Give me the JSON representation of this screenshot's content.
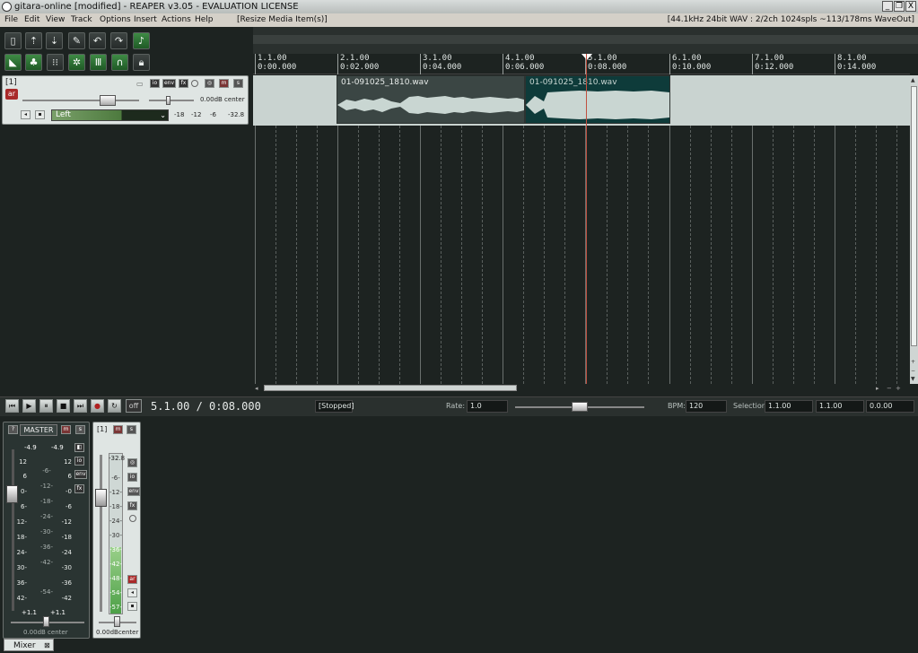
{
  "window": {
    "title": "gitara-online [modified] - REAPER v3.05 - EVALUATION LICENSE",
    "controls": [
      "_",
      "❐",
      "X"
    ]
  },
  "menu": {
    "items": [
      "File",
      "Edit",
      "View",
      "Track",
      "Options",
      "Insert",
      "Actions",
      "Help"
    ],
    "last_action": "[Resize Media Item(s)]",
    "audio_status": "[44.1kHz 24bit WAV : 2/2ch 1024spls ~113/178ms WaveOut]"
  },
  "toolbar": {
    "icons": [
      "new-project-icon",
      "open-project-icon",
      "save-project-icon",
      "preferences-icon",
      "undo-icon",
      "redo-icon",
      "metronome-icon",
      "snap-icon",
      "ripple-icon",
      "grid-icon",
      "auto-crossfade-icon",
      "envelope-lock-icon",
      "item-lock-icon",
      "lock-icon"
    ]
  },
  "track": {
    "number": "[1]",
    "arm_label": "ar",
    "io_label": "io",
    "env_label": "env",
    "fx_label": "fx",
    "mute_label": "m",
    "solo_label": "s",
    "pan_readout": "0.00dB center",
    "input_select": "Left",
    "meter_ticks": [
      "-18",
      "-12",
      "-6",
      "-32.8"
    ]
  },
  "ruler": {
    "marks": [
      {
        "bar": "1.1.00",
        "time": "0:00.000"
      },
      {
        "bar": "2.1.00",
        "time": "0:02.000"
      },
      {
        "bar": "3.1.00",
        "time": "0:04.000"
      },
      {
        "bar": "4.1.00",
        "time": "0:06.000"
      },
      {
        "bar": "5.1.00",
        "time": "0:08.000"
      },
      {
        "bar": "6.1.00",
        "time": "0:10.000"
      },
      {
        "bar": "7.1.00",
        "time": "0:12.000"
      },
      {
        "bar": "8.1.00",
        "time": "0:14.000"
      }
    ]
  },
  "items": [
    {
      "name": "01-091025_1810.wav"
    },
    {
      "name": "01-091025_1810.wav"
    }
  ],
  "transport": {
    "buttons": [
      "go-to-start",
      "play",
      "pause",
      "stop",
      "go-to-end",
      "record",
      "repeat"
    ],
    "off_label": "off",
    "position": "5.1.00 / 0:08.000",
    "status": "[Stopped]",
    "rate_label": "Rate:",
    "rate_value": "1.0",
    "bpm_label": "BPM:",
    "bpm_value": "120",
    "selection_label": "Selection:",
    "selection_start": "1.1.00",
    "selection_end": "1.1.00",
    "selection_length": "0.0.00"
  },
  "mixer": {
    "master": {
      "label": "MASTER",
      "peak_left": "-4.9",
      "peak_right": "-4.9",
      "scale_left": [
        "12",
        "6",
        "0-",
        "6-",
        "12-",
        "18-",
        "24-",
        "30-",
        "36-",
        "42-"
      ],
      "scale_mid": [
        "-6-",
        "-12-",
        "-18-",
        "-24-",
        "-30-",
        "-36-",
        "-42-",
        "-54-"
      ],
      "scale_right": [
        "12",
        "6",
        "-0",
        "-6",
        "-12",
        "-18",
        "-24",
        "-30",
        "-36",
        "-42"
      ],
      "bottom_left": "+1.1",
      "bottom_right": "+1.1",
      "pan_readout": "0.00dB center"
    },
    "channel": {
      "label": "[1]",
      "peak": "-32.8",
      "scale": [
        "-6-",
        "-12-",
        "-18-",
        "-24-",
        "-30-",
        "-36-",
        "-42-",
        "-48-",
        "-54-",
        "-57-"
      ],
      "pan_readout": "0.00dBcenter"
    },
    "tab_label": "Mixer"
  },
  "colors": {
    "background": "#1d2321",
    "track_lane": "#c9d3d0",
    "item_dark": "#3b4644",
    "item_selected": "#0e3b3a",
    "waveform": "#c9d6d2",
    "play_cursor": "#c05040",
    "arm_red": "#a92a2a",
    "meter_green": "#2f8a3c"
  }
}
